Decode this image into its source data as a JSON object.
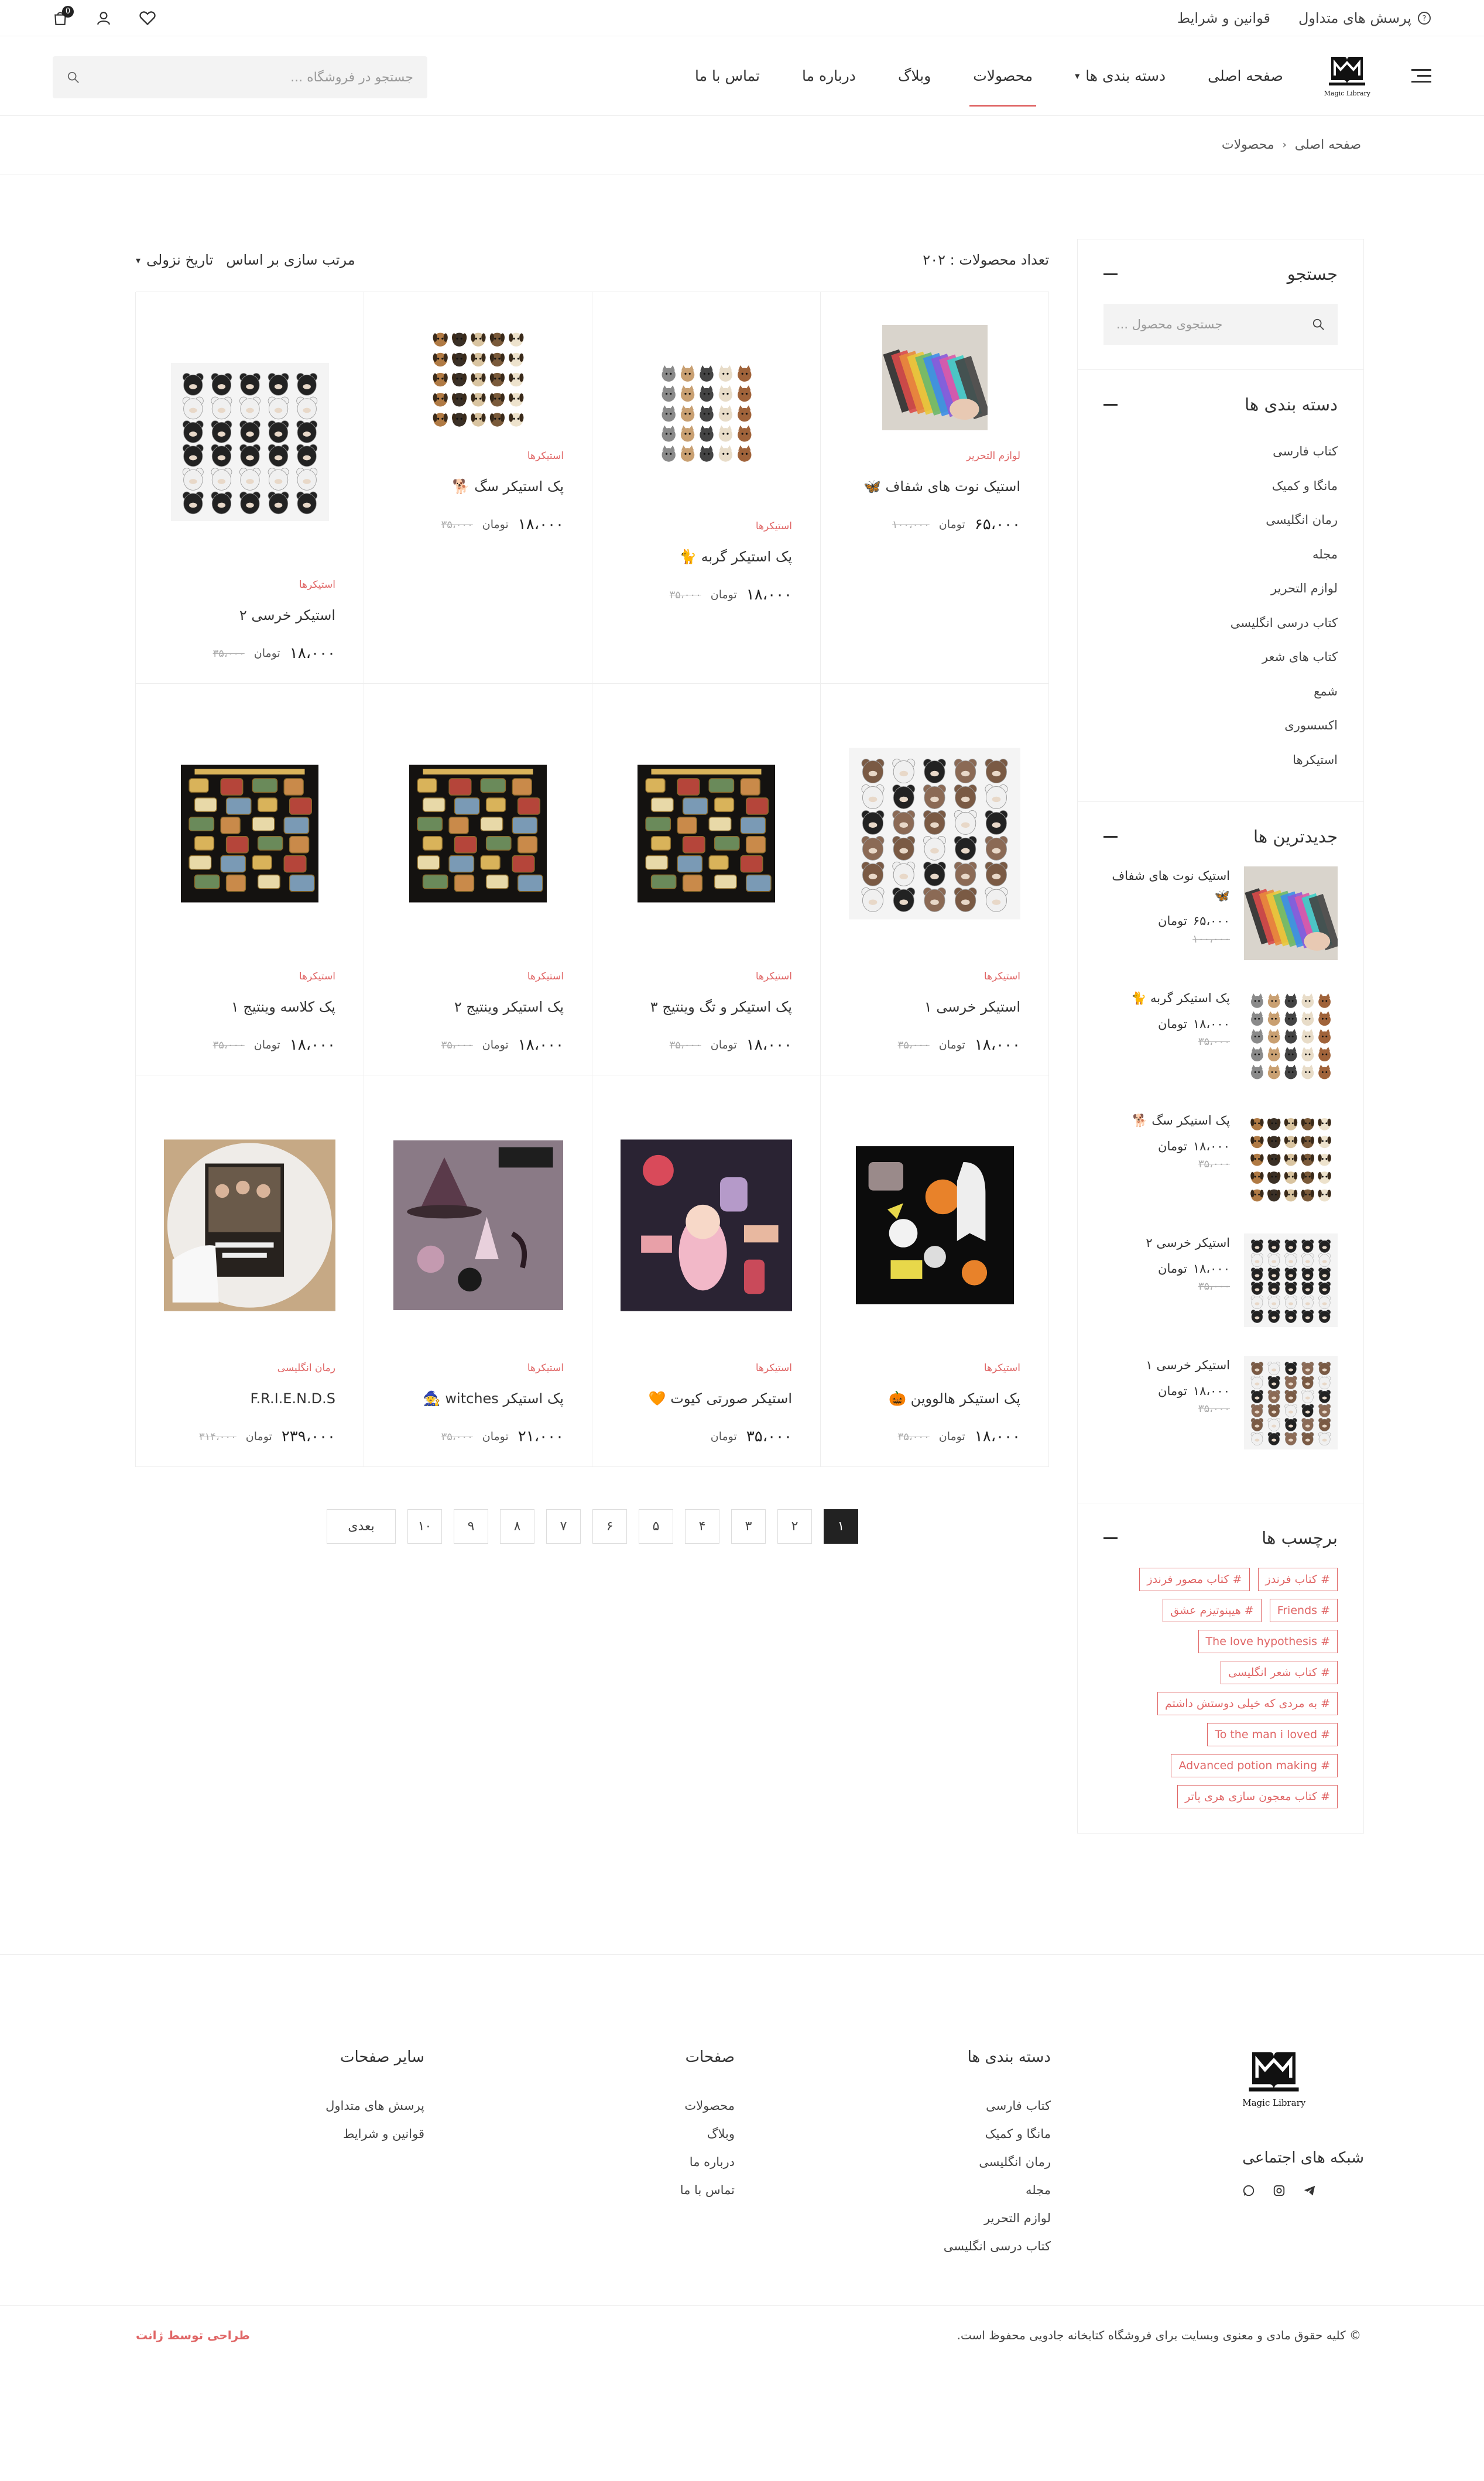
{
  "topbar": {
    "faq": "پرسش های متداول",
    "terms": "قوانین و شرایط",
    "cart_count": "0"
  },
  "header": {
    "logo_text": "Magic Library",
    "menu": [
      "صفحه اصلی",
      "دسته بندی ها",
      "محصولات",
      "وبلاگ",
      "درباره ما",
      "تماس با ما"
    ],
    "search_placeholder": "جستجو در فروشگاه ..."
  },
  "breadcrumb": {
    "home": "صفحه اصلی",
    "current": "محصولات"
  },
  "toolbar": {
    "count": "تعداد محصولات : ۲۰۲",
    "sort_label": "مرتب سازی بر اساس",
    "sort_value": "تاریخ نزولی"
  },
  "sidebar": {
    "search_title": "جستجو",
    "search_placeholder": "جستجوی محصول ...",
    "cat_title": "دسته بندی ها",
    "categories": [
      "کتاب فارسی",
      "مانگا و کمیک",
      "رمان انگلیسی",
      "مجله",
      "لوازم التحریر",
      "کتاب درسی انگلیسی",
      "کتاب های شعر",
      "شمع",
      "اکسسوری",
      "استیکرها"
    ],
    "latest_title": "جدیدترین ها",
    "latest": [
      {
        "title": "استیک نوت های شفاف 🦋",
        "price": "۶۵،۰۰۰",
        "unit": "تومان",
        "old": "۱۰۰،۰۰۰"
      },
      {
        "title": "پک استیکر گربه 🐈",
        "price": "۱۸،۰۰۰",
        "unit": "تومان",
        "old": "۳۵،۰۰۰"
      },
      {
        "title": "پک استیکر سگ 🐕",
        "price": "۱۸،۰۰۰",
        "unit": "تومان",
        "old": "۳۵،۰۰۰"
      },
      {
        "title": "استیکر خرسی ۲",
        "price": "۱۸،۰۰۰",
        "unit": "تومان",
        "old": "۳۵،۰۰۰"
      },
      {
        "title": "استیکر خرسی ۱",
        "price": "۱۸،۰۰۰",
        "unit": "تومان",
        "old": "۳۵،۰۰۰"
      }
    ],
    "tags_title": "برچسب ها",
    "tags": [
      [
        "# کتاب فرندز",
        "# کتاب مصور فرندز"
      ],
      [
        "# Friends",
        "# هیپنوتیزم عشق"
      ],
      [
        "# The love hypothesis"
      ],
      [
        "# کتاب شعر انگلیسی"
      ],
      [
        "# به مردی که خیلی دوستش داشتم"
      ],
      [
        "# To the man i loved"
      ],
      [
        "# Advanced potion making"
      ],
      [
        "# کتاب معجون سازی هری پاتر"
      ]
    ]
  },
  "products": [
    {
      "cat": "لوازم التحریر",
      "title": "استیک نوت های شفاف 🦋",
      "price": "۶۵،۰۰۰",
      "unit": "تومان",
      "old": "۱۰۰،۰۰۰",
      "img": "notes"
    },
    {
      "cat": "استیکرها",
      "title": "پک استیکر گربه 🐈",
      "price": "۱۸،۰۰۰",
      "unit": "تومان",
      "old": "۳۵،۰۰۰",
      "img": "cats"
    },
    {
      "cat": "استیکرها",
      "title": "پک استیکر سگ 🐕",
      "price": "۱۸،۰۰۰",
      "unit": "تومان",
      "old": "۳۵،۰۰۰",
      "img": "dogs"
    },
    {
      "cat": "استیکرها",
      "title": "استیکر خرسی ۲",
      "price": "۱۸،۰۰۰",
      "unit": "تومان",
      "old": "۳۵،۰۰۰",
      "img": "bears2"
    },
    {
      "cat": "استیکرها",
      "title": "استیکر خرسی ۱",
      "price": "۱۸،۰۰۰",
      "unit": "تومان",
      "old": "۳۵،۰۰۰",
      "img": "bears1"
    },
    {
      "cat": "استیکرها",
      "title": "پک استیکر و تگ وینتیج ۳",
      "price": "۱۸،۰۰۰",
      "unit": "تومان",
      "old": "۳۵،۰۰۰",
      "img": "vintage"
    },
    {
      "cat": "استیکرها",
      "title": "پک استیکر وینتیج ۲",
      "price": "۱۸،۰۰۰",
      "unit": "تومان",
      "old": "۳۵،۰۰۰",
      "img": "vintage"
    },
    {
      "cat": "استیکرها",
      "title": "پک کلاسه وینتیج ۱",
      "price": "۱۸،۰۰۰",
      "unit": "تومان",
      "old": "۳۵،۰۰۰",
      "img": "vintage"
    },
    {
      "cat": "استیکرها",
      "title": "پک استیکر هالووین 🎃",
      "price": "۱۸،۰۰۰",
      "unit": "تومان",
      "old": "۳۵،۰۰۰",
      "img": "halloween"
    },
    {
      "cat": "استیکرها",
      "title": "استیکر صورتی کیوت 🧡",
      "price": "۳۵،۰۰۰",
      "unit": "تومان",
      "old": "",
      "img": "pink"
    },
    {
      "cat": "استیکرها",
      "title": "پک استیکر witches 🧙",
      "price": "۲۱،۰۰۰",
      "unit": "تومان",
      "old": "۳۵،۰۰۰",
      "img": "witches"
    },
    {
      "cat": "رمان انگلیسی",
      "title": "F.R.I.E.N.D.S",
      "price": "۲۳۹،۰۰۰",
      "unit": "تومان",
      "old": "۳۱۴،۰۰۰",
      "img": "friends"
    }
  ],
  "pagination": {
    "pages": [
      "۱",
      "۲",
      "۳",
      "۴",
      "۵",
      "۶",
      "۷",
      "۸",
      "۹",
      "۱۰"
    ],
    "next": "بعدی"
  },
  "footer": {
    "social_title": "شبکه های اجتماعی",
    "cols": [
      {
        "title": "دسته بندی ها",
        "items": [
          "کتاب فارسی",
          "مانگا و کمیک",
          "رمان انگلیسی",
          "مجله",
          "لوازم التحریر",
          "کتاب درسی انگلیسی"
        ]
      },
      {
        "title": "صفحات",
        "items": [
          "محصولات",
          "وبلاگ",
          "درباره ما",
          "تماس با ما"
        ]
      },
      {
        "title": "سایر صفحات",
        "items": [
          "پرسش های متداول",
          "قوانین و شرایط"
        ]
      }
    ],
    "copyright": "© کلیه حقوق مادی و معنوی وبسایت برای فروشگاه کتابخانه جادویی محفوظ است.",
    "designer": "طراحی توسط ژانت"
  },
  "colors": {
    "accent": "#e06666",
    "dark": "#222222"
  }
}
